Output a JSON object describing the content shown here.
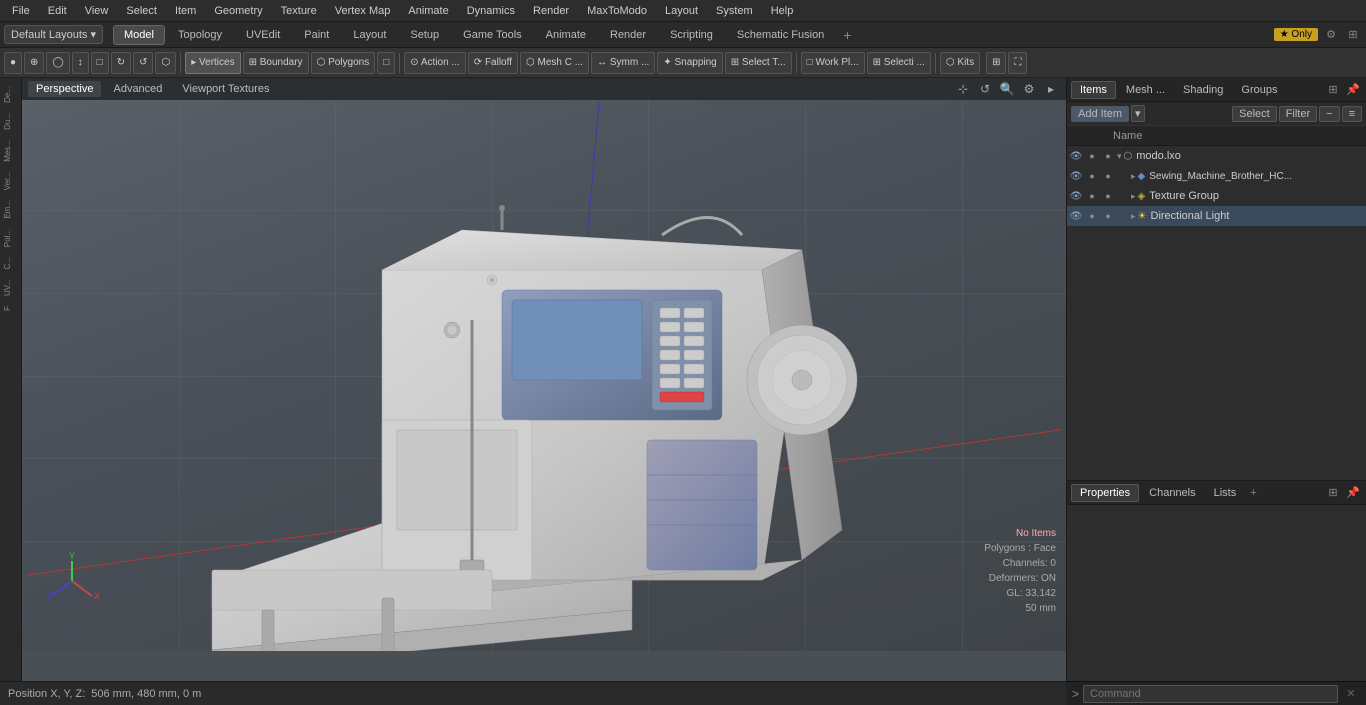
{
  "menu": {
    "items": [
      "File",
      "Edit",
      "View",
      "Select",
      "Item",
      "Geometry",
      "Texture",
      "Vertex Map",
      "Animate",
      "Dynamics",
      "Render",
      "MaxToModo",
      "Layout",
      "System",
      "Help"
    ]
  },
  "layout": {
    "dropdown": "Default Layouts ▾",
    "tabs": [
      "Model",
      "Topology",
      "UVEdit",
      "Paint",
      "Layout",
      "Setup",
      "Game Tools",
      "Animate",
      "Render",
      "Scripting",
      "Schematic Fusion"
    ],
    "active_tab": "Model",
    "plus_label": "+",
    "badge": "★ Only"
  },
  "toolbar": {
    "buttons": [
      {
        "label": "●",
        "id": "dot-btn"
      },
      {
        "label": "⊕",
        "id": "target-btn"
      },
      {
        "label": "◯",
        "id": "circle-btn"
      },
      {
        "label": "↕",
        "id": "arrow-btn"
      },
      {
        "label": "□",
        "id": "rect-btn"
      },
      {
        "label": "⟲",
        "id": "rotate-btn"
      },
      {
        "label": "⟳",
        "id": "rotate2-btn"
      },
      {
        "label": "⬡",
        "id": "hex-btn"
      },
      {
        "label": "▸ Vertices",
        "id": "vertices-btn"
      },
      {
        "label": "⊞ Boundary",
        "id": "boundary-btn"
      },
      {
        "label": "⬡ Polygons",
        "id": "polygons-btn"
      },
      {
        "label": "□",
        "id": "square-btn"
      },
      {
        "label": "⊙ Action ...",
        "id": "action-btn"
      },
      {
        "label": "⟳ Falloff",
        "id": "falloff-btn"
      },
      {
        "label": "⬡ Mesh C ...",
        "id": "meshc-btn"
      },
      {
        "label": "↔ Symm ...",
        "id": "symm-btn"
      },
      {
        "label": "✦ Snapping",
        "id": "snapping-btn"
      },
      {
        "label": "⊞ Select T...",
        "id": "selectt-btn"
      },
      {
        "label": "□ Work Pl...",
        "id": "workpl-btn"
      },
      {
        "label": "⊞ Selecti ...",
        "id": "selecti-btn"
      },
      {
        "label": "⬡ Kits",
        "id": "kits-btn"
      }
    ]
  },
  "viewport": {
    "tabs": [
      "Perspective",
      "Advanced",
      "Viewport Textures"
    ],
    "active_tab": "Perspective",
    "info": {
      "no_items": "No Items",
      "polygons": "Polygons : Face",
      "channels": "Channels: 0",
      "deformers": "Deformers: ON",
      "gl": "GL: 33,142",
      "zoom": "50 mm"
    }
  },
  "left_sidebar": {
    "items": [
      "De...",
      "Du...",
      "Mes...",
      "Ver...",
      "Em...",
      "Pol...",
      "C...",
      "UV...",
      "F"
    ]
  },
  "right_panel": {
    "tabs": [
      "Items",
      "Mesh ...",
      "Shading",
      "Groups"
    ],
    "active_tab": "Items",
    "toolbar": {
      "add_item": "Add Item",
      "select": "Select",
      "filter": "Filter"
    },
    "col_headers": [
      "Name"
    ],
    "items": [
      {
        "name": "modo.lxo",
        "level": 0,
        "icon": "📦",
        "eye": true,
        "expanded": true,
        "type": "scene"
      },
      {
        "name": "Sewing_Machine_Brother_HC...",
        "level": 1,
        "icon": "🔷",
        "eye": true,
        "expanded": false,
        "type": "mesh"
      },
      {
        "name": "Texture Group",
        "level": 1,
        "icon": "🎨",
        "eye": true,
        "expanded": false,
        "type": "texture"
      },
      {
        "name": "Directional Light",
        "level": 1,
        "icon": "💡",
        "eye": true,
        "expanded": false,
        "type": "light"
      }
    ]
  },
  "properties_panel": {
    "tabs": [
      "Properties",
      "Channels",
      "Lists"
    ],
    "active_tab": "Properties",
    "plus": "+"
  },
  "status_bar": {
    "position_label": "Position X, Y, Z:",
    "position_value": "506 mm, 480 mm, 0 m"
  },
  "command_bar": {
    "arrow": ">",
    "placeholder": "Command"
  },
  "axis": {
    "x_label": "X",
    "y_label": "Y",
    "z_label": "Z"
  }
}
